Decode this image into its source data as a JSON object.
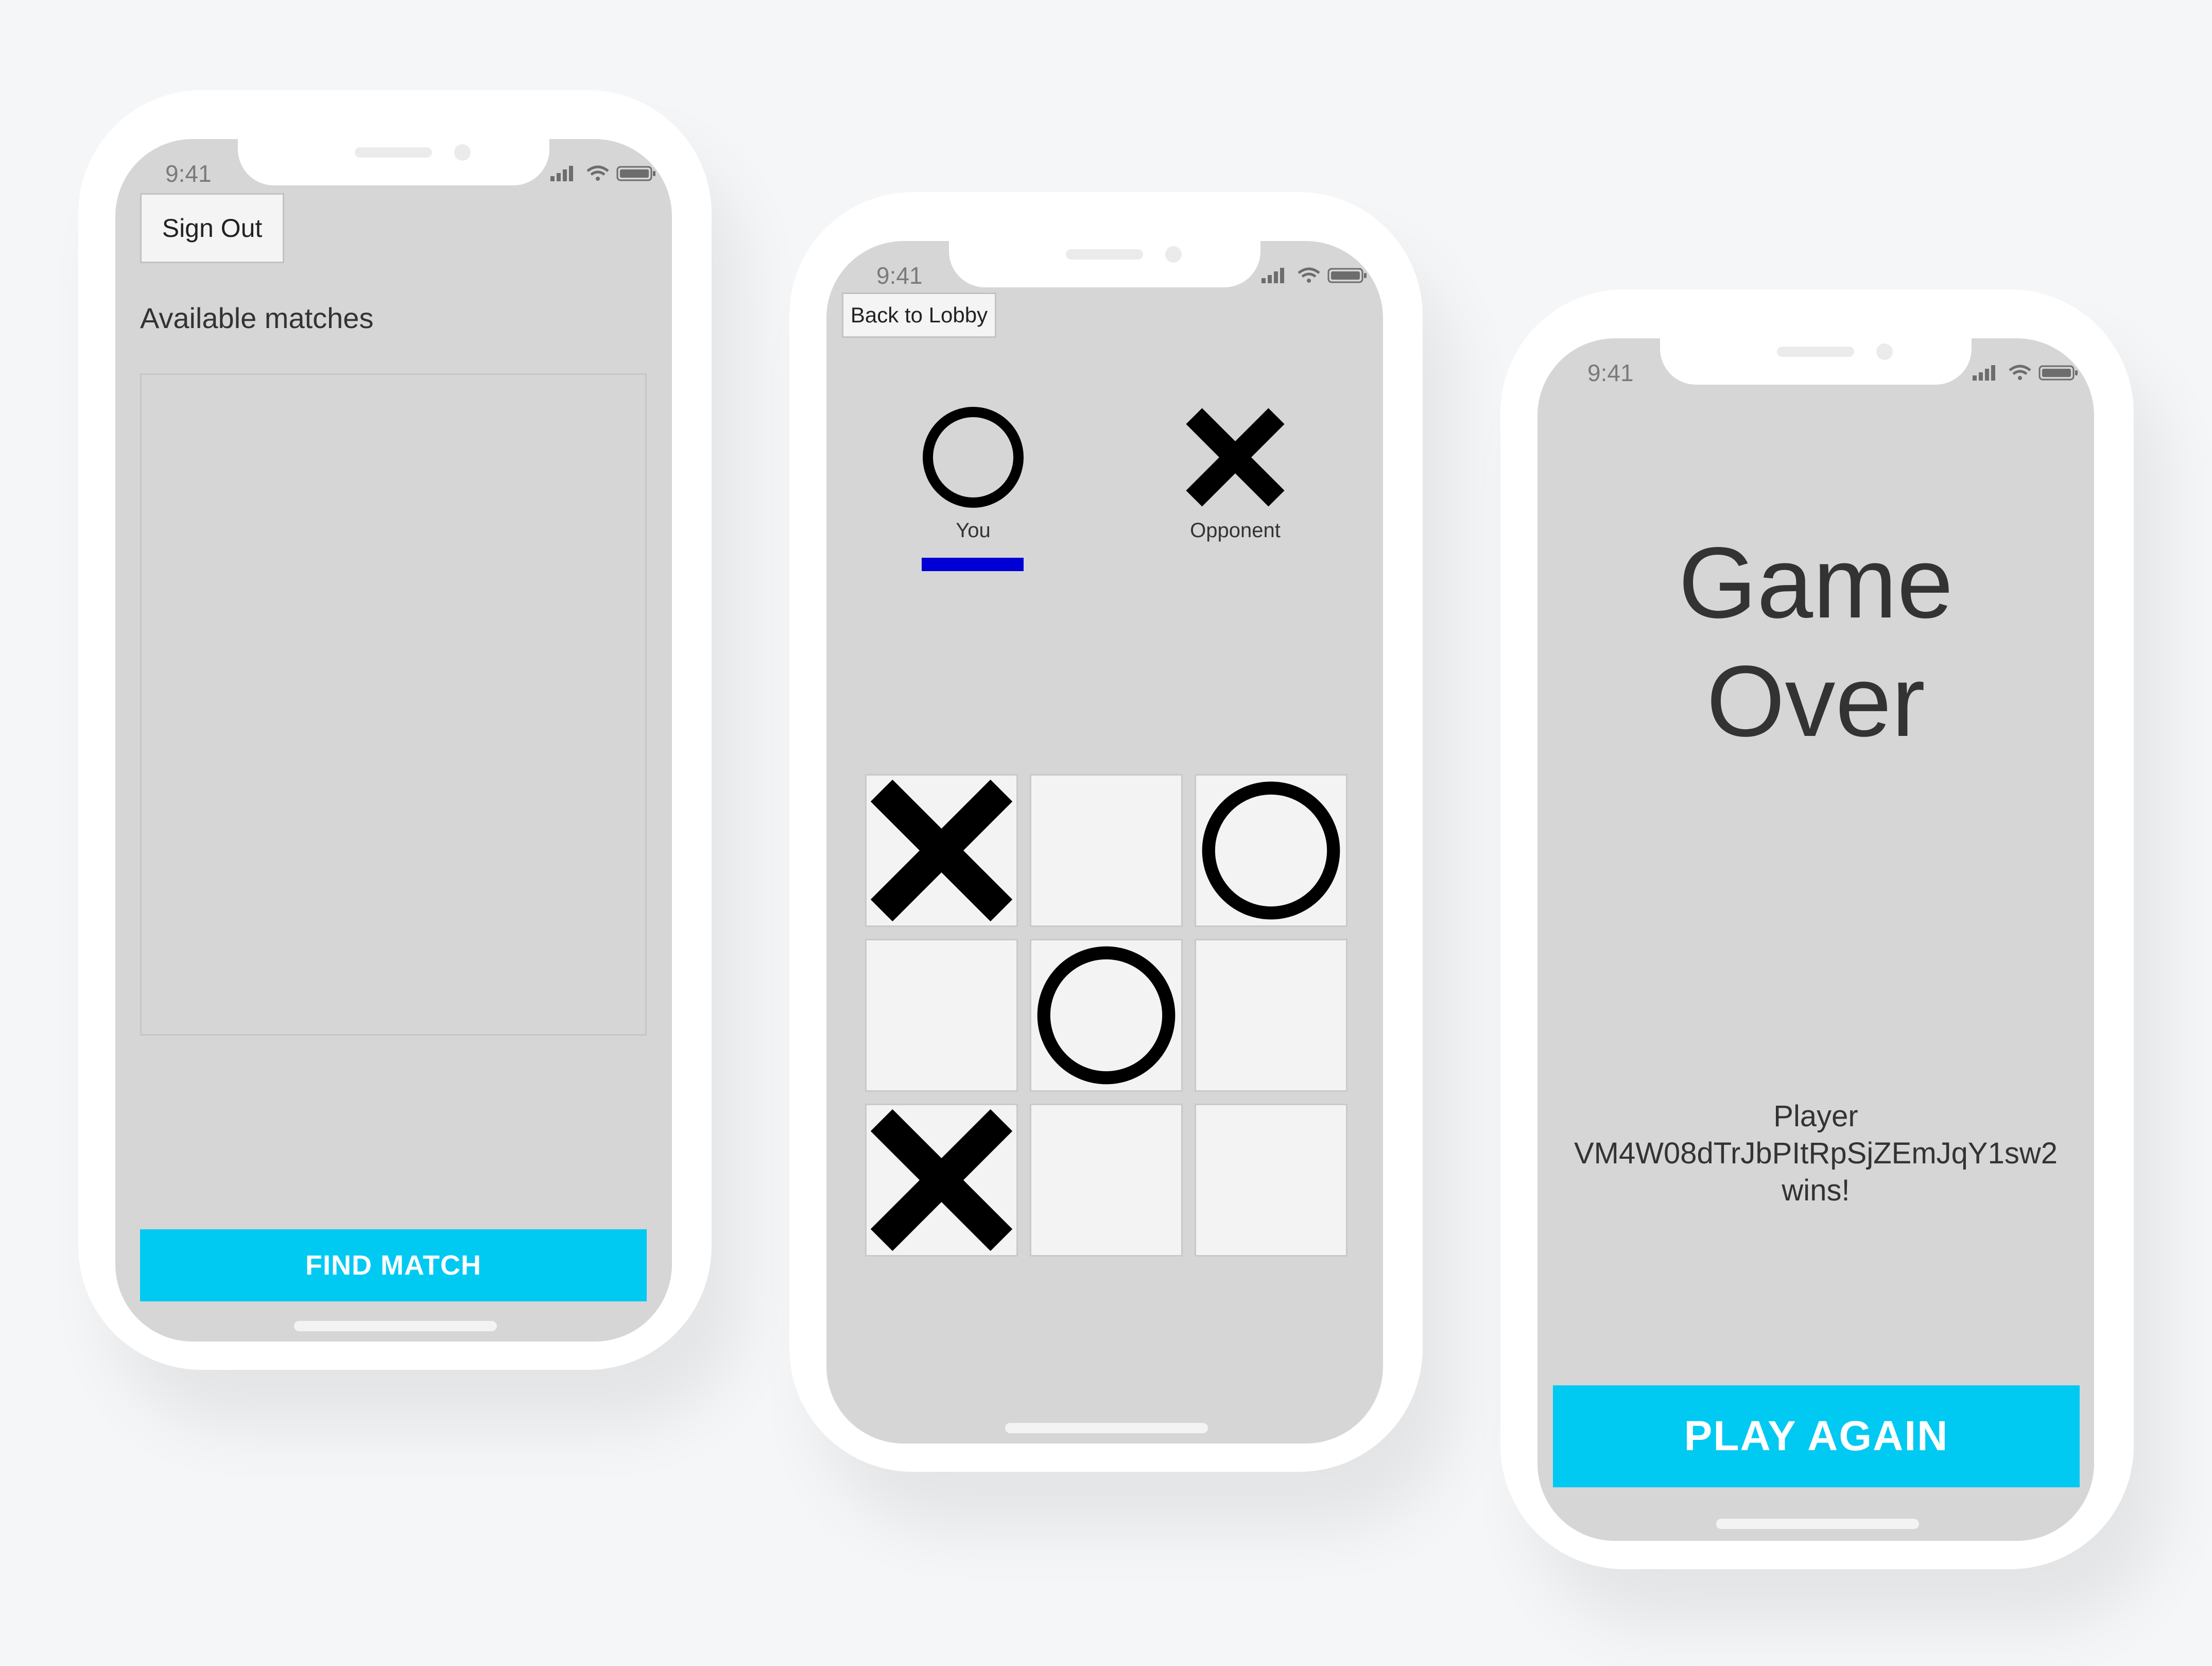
{
  "status_bar": {
    "time": "9:41"
  },
  "lobby": {
    "sign_out_label": "Sign Out",
    "matches_title": "Available matches",
    "find_match_label": "FIND MATCH"
  },
  "game": {
    "back_label": "Back to Lobby",
    "players": [
      {
        "label": "You",
        "mark": "O"
      },
      {
        "label": "Opponent",
        "mark": "X"
      }
    ],
    "turn_color": "#0000d4",
    "board": [
      "X",
      "",
      "O",
      "",
      "O",
      "",
      "X",
      "",
      ""
    ]
  },
  "game_over": {
    "title_line1": "Game",
    "title_line2": "Over",
    "winner_line1": "Player",
    "winner_line2": "VM4W08dTrJbPItRpSjZEmJqY1sw2",
    "winner_line3": "wins!",
    "play_again_label": "PLAY AGAIN"
  },
  "colors": {
    "accent": "#00c9f2",
    "screen": "#d6d6d6",
    "cell": "#f3f3f3"
  }
}
